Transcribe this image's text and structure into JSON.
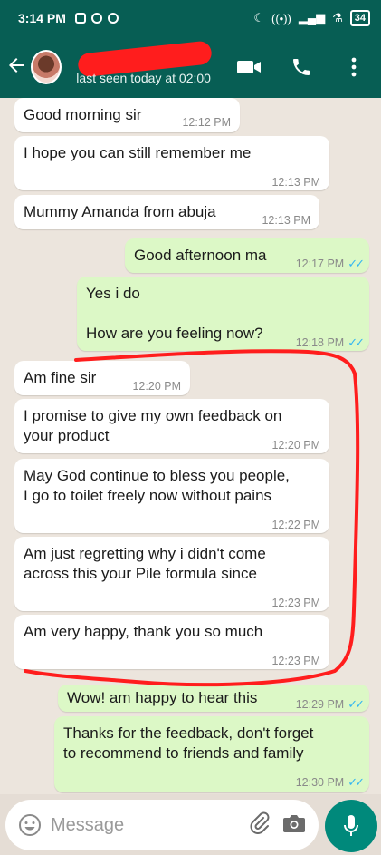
{
  "status_bar": {
    "time": "3:14 PM",
    "battery": "34"
  },
  "header": {
    "last_seen": "last seen today at 02:00"
  },
  "messages": [
    {
      "dir": "in",
      "text": "Good morning sir",
      "time": "12:12 PM"
    },
    {
      "dir": "in",
      "text": "I hope you can still remember me",
      "time": "12:13 PM"
    },
    {
      "dir": "in",
      "text": "Mummy Amanda from abuja",
      "time": "12:13 PM"
    },
    {
      "dir": "out",
      "text": "Good afternoon ma",
      "time": "12:17 PM",
      "read": true
    },
    {
      "dir": "out",
      "line1": "Yes i do",
      "line2": "How are you feeling now?",
      "time": "12:18 PM",
      "read": true
    },
    {
      "dir": "in",
      "text": "Am fine sir",
      "time": "12:20 PM"
    },
    {
      "dir": "in",
      "line1": "I promise to give my own feedback on",
      "line2": "your product",
      "time": "12:20 PM"
    },
    {
      "dir": "in",
      "line1": "May God continue to bless you people,",
      "line2": "I go to toilet freely now without pains",
      "time": "12:22 PM"
    },
    {
      "dir": "in",
      "line1": "Am just regretting why i didn't come",
      "line2": "across this your Pile formula since",
      "time": "12:23 PM"
    },
    {
      "dir": "in",
      "text": "Am very happy, thank you so much",
      "time": "12:23 PM"
    },
    {
      "dir": "out",
      "text": "Wow!  am happy to hear this",
      "time": "12:29 PM",
      "read": true
    },
    {
      "dir": "out",
      "line1": "Thanks for the feedback, don't forget",
      "line2": "to recommend to friends and family",
      "time": "12:30 PM",
      "read": true
    }
  ],
  "input": {
    "placeholder": "Message"
  },
  "colors": {
    "header": "#075e54",
    "outgoing": "#dcf8c6",
    "incoming": "#ffffff",
    "annotation": "#ff1d1d",
    "read_ticks": "#34b7f1",
    "mic": "#00897b"
  }
}
